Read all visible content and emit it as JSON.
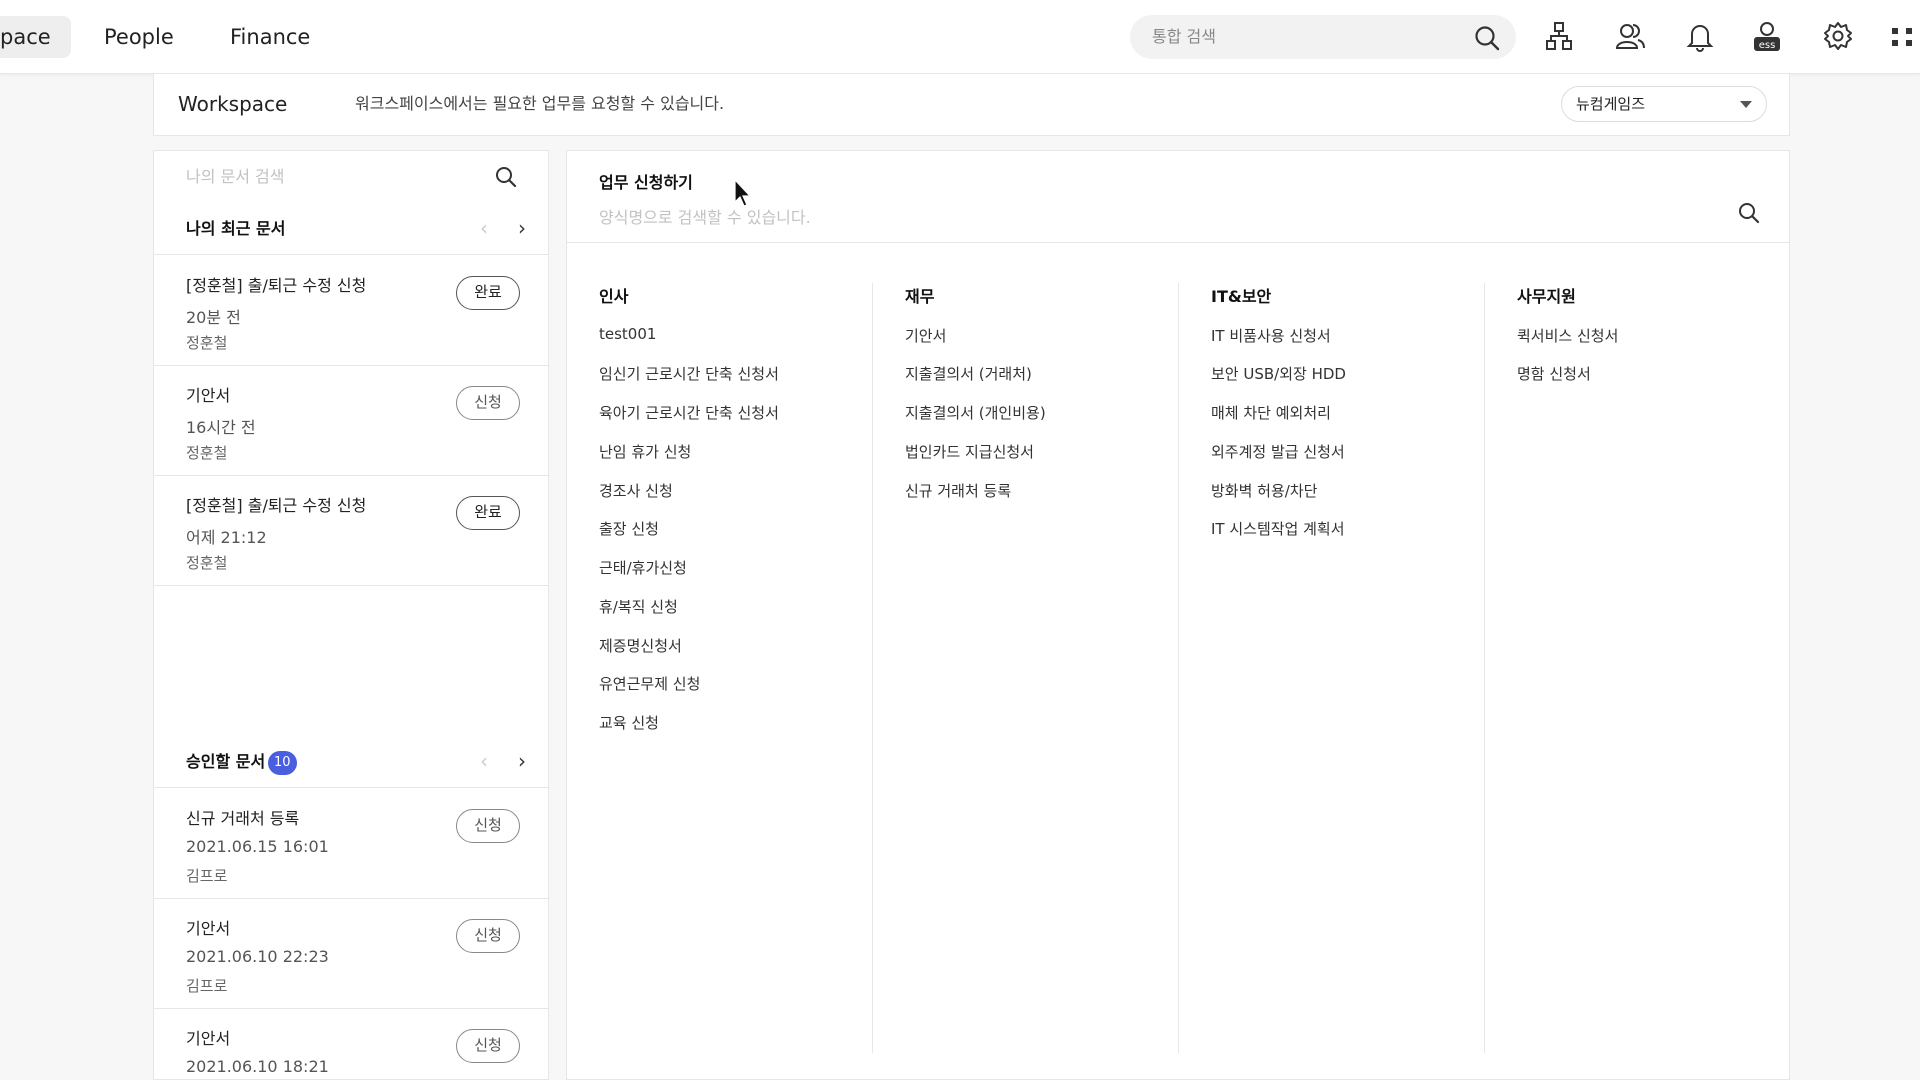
{
  "nav": {
    "tabs": [
      {
        "label": "pace",
        "active": true
      },
      {
        "label": "People",
        "active": false
      },
      {
        "label": "Finance",
        "active": false
      }
    ],
    "search_placeholder": "통합 검색",
    "tool_icons": [
      "org-chart-icon",
      "people-icon",
      "bell-icon",
      "ess-icon",
      "gear-icon",
      "apps-grid-icon"
    ],
    "ess_label": "ess"
  },
  "workspace": {
    "title": "Workspace",
    "description": "워크스페이스에서는 필요한 업무를 요청할 수 있습니다.",
    "company_select": "뉴컴게임즈"
  },
  "left": {
    "search_placeholder": "나의 문서 검색",
    "recent": {
      "title": "나의 최근 문서",
      "items": [
        {
          "title": "[정훈철] 출/퇴근 수정 신청",
          "time": "20분 전",
          "author": "정훈철",
          "status": "완료"
        },
        {
          "title": "기안서",
          "time": "16시간 전",
          "author": "정훈철",
          "status": "신청"
        },
        {
          "title": "[정훈철] 출/퇴근 수정 신청",
          "time": "어제 21:12",
          "author": "정훈철",
          "status": "완료"
        }
      ]
    },
    "approve": {
      "title": "승인할 문서",
      "count": "10",
      "items": [
        {
          "title": "신규 거래처 등록",
          "time": "2021.06.15 16:01",
          "author": "김프로",
          "status": "신청"
        },
        {
          "title": "기안서",
          "time": "2021.06.10 22:23",
          "author": "김프로",
          "status": "신청"
        },
        {
          "title": "기안서",
          "time": "2021.06.10 18:21",
          "author": "",
          "status": "신청"
        }
      ]
    },
    "prev_glyph": "‹",
    "next_glyph": "›"
  },
  "main": {
    "title": "업무 신청하기",
    "search_placeholder": "양식명으로 검색할 수 있습니다.",
    "columns": [
      {
        "title": "인사",
        "items": [
          "test001",
          "임신기 근로시간 단축 신청서",
          "육아기 근로시간 단축 신청서",
          "난임 휴가 신청",
          "경조사 신청",
          "출장 신청",
          "근태/휴가신청",
          "휴/복직 신청",
          "제증명신청서",
          "유연근무제 신청",
          "교육 신청"
        ]
      },
      {
        "title": "재무",
        "items": [
          "기안서",
          "지출결의서 (거래처)",
          "지출결의서 (개인비용)",
          "법인카드 지급신청서",
          "신규 거래처 등록"
        ]
      },
      {
        "title": "IT&보안",
        "items": [
          "IT 비품사용 신청서",
          "보안 USB/외장 HDD",
          "매체 차단 예외처리",
          "외주계정 발급 신청서",
          "방화벽 허용/차단",
          "IT 시스템작업 계획서"
        ]
      },
      {
        "title": "사무지원",
        "items": [
          "퀵서비스 신청서",
          "명함 신청서"
        ]
      }
    ]
  }
}
